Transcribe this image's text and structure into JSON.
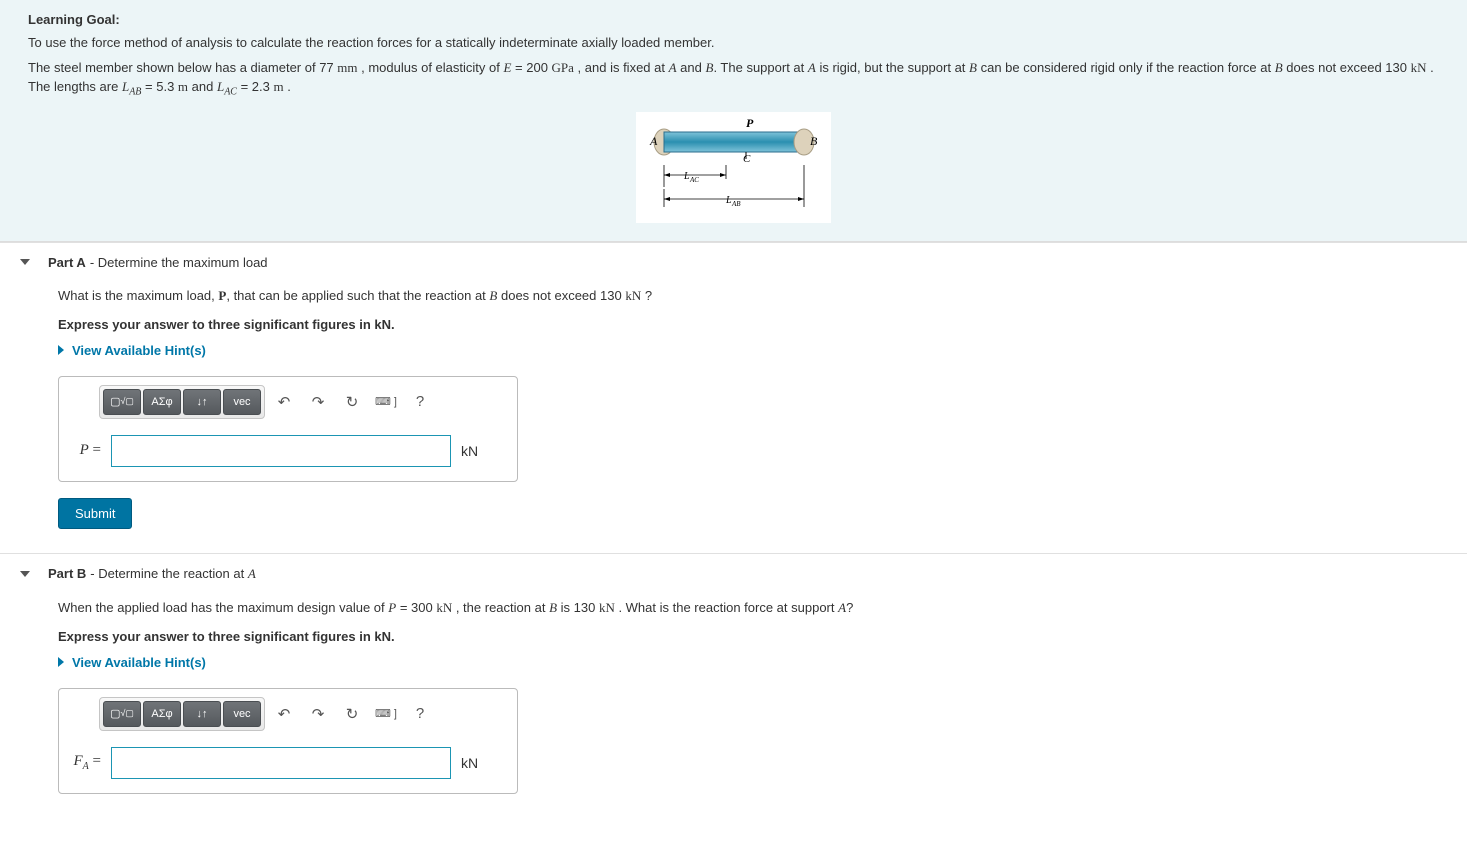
{
  "learning_goal": {
    "title": "Learning Goal:",
    "line1": "To use the force method of analysis to calculate the reaction forces for a statically indeterminate axially loaded member.",
    "line2_pre": "The steel member shown below has a diameter of 77 ",
    "unit_mm": "mm",
    "line2_mid1": " , modulus of elasticity of ",
    "E": "E",
    "eq": " = 200 ",
    "GPa": "GPa",
    "line2_mid2": " , and is fixed at ",
    "A": "A",
    "and": " and ",
    "B": "B",
    "line2_mid3": ". The support at ",
    "line2_mid4": " is rigid, but the support at ",
    "line2_mid5": " can be considered rigid only if the reaction force at ",
    "line2_mid6": " does not exceed 130 ",
    "kN": "kN",
    "line2_end": " . The lengths are ",
    "L": "L",
    "AB": "AB",
    "val1": " = 5.3 ",
    "m": "m",
    "and2": " and ",
    "AC": "AC",
    "val2": " = 2.3 ",
    "period": " ."
  },
  "figure": {
    "P": "P",
    "A": "A",
    "B": "B",
    "C": "C",
    "LAC": "L",
    "LAC_sub": "AC",
    "LAB": "L",
    "LAB_sub": "AB"
  },
  "partA": {
    "header_label": "Part A",
    "header_sub": " - Determine the maximum load",
    "q_pre": "What is the maximum load, ",
    "P": "P",
    "q_mid": ", that can be applied such that the reaction at ",
    "B": "B",
    "q_mid2": " does not exceed 130 ",
    "kN": "kN",
    "q_end": " ?",
    "express": "Express your answer to three significant figures in kN.",
    "hints": "View Available Hint(s)",
    "var": "P",
    "eq": " =",
    "unit": "kN",
    "submit": "Submit"
  },
  "partB": {
    "header_label": "Part B",
    "header_sub": " - Determine the reaction at ",
    "header_A": "A",
    "q_pre": "When the applied load has the maximum design value of ",
    "P": "P",
    "q_mid1": " = 300 ",
    "kN": "kN",
    "q_mid2": " , the reaction at ",
    "B": "B",
    "q_mid3": " is 130 ",
    "q_mid4": " . What is the reaction force at support ",
    "A": "A",
    "q_end": "?",
    "express": "Express your answer to three significant figures in kN.",
    "hints": "View Available Hint(s)",
    "var": "F",
    "var_sub": "A",
    "eq": " =",
    "unit": "kN"
  },
  "toolbar": {
    "template": "▢",
    "sqrt": "√▢",
    "greek": "ΑΣφ",
    "arrows": "↓↑",
    "vec": "vec",
    "undo": "↶",
    "redo": "↷",
    "reset": "↻",
    "keyboard": "⌨ ]",
    "help": "?"
  }
}
